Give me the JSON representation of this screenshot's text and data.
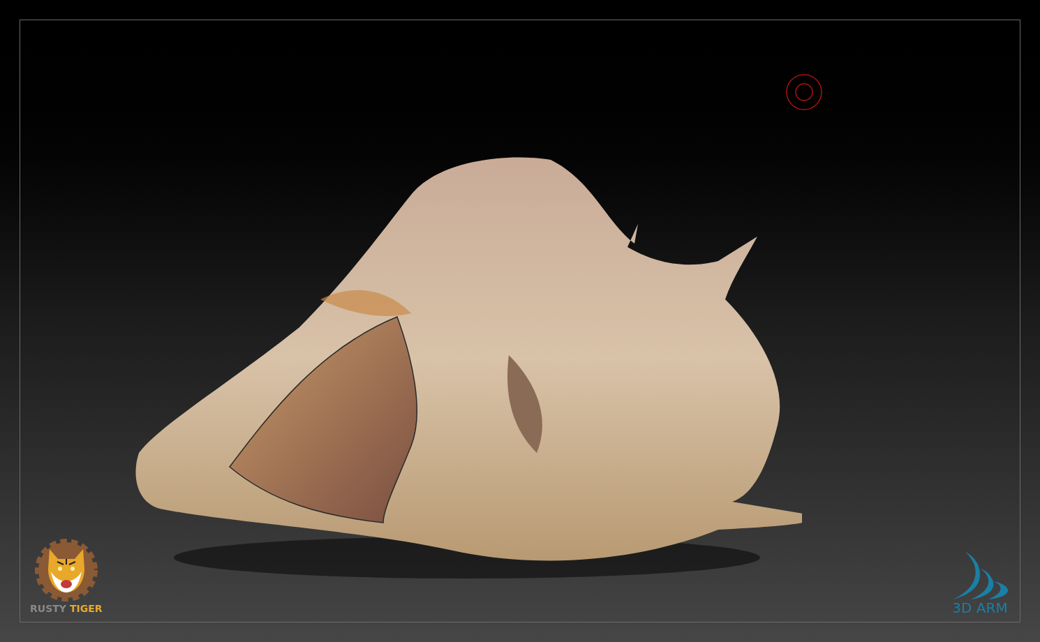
{
  "logos": {
    "left": {
      "words": [
        "RUSTY",
        "TIGER"
      ]
    },
    "right": {
      "text": "3D ARM"
    }
  }
}
